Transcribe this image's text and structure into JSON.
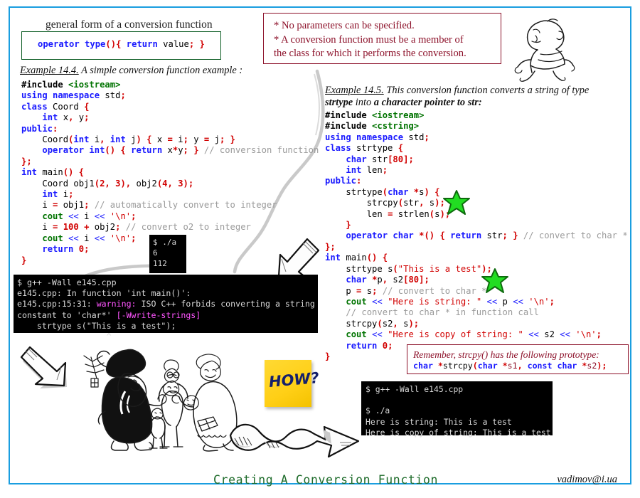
{
  "slide": {
    "title": "Creating A Conversion Function",
    "signature": "vadimov@i.ua",
    "border_color": "#1a9ee0"
  },
  "general_form": {
    "label": "general form of a conversion function",
    "code": "operator type(){ return value; }",
    "border_color": "#0b5c22"
  },
  "rules_note": {
    "line1": "* No parameters can be specified.",
    "line2": "* A conversion function must be a member of",
    "line3": "the class for which it performs the conversion.",
    "color": "#8c1029"
  },
  "example_444": {
    "number": "Example 14.4.",
    "caption": "A simple conversion function example :"
  },
  "example_445": {
    "number": "Example 14.5.",
    "caption_part1": "This conversion function converts a string of type",
    "caption_bold1": "strtype",
    "caption_part2": "into",
    "caption_bold2": "a character pointer to str:"
  },
  "code_left": [
    "#include <iostream>",
    "using namespace std;",
    "class Coord {",
    "    int x, y;",
    "public:",
    "    Coord(int i, int j) { x = i; y = j; }",
    "    operator int() { return x*y; } // conversion function",
    "};",
    "int main() {",
    "    Coord obj1(2, 3), obj2(4, 3);",
    "    int i;",
    "    i = obj1; // automatically convert to integer",
    "    cout << i << '\\n';",
    "    i = 100 + obj2; // convert o2 to integer",
    "    cout << i << '\\n';",
    "    return 0;",
    "}"
  ],
  "code_right": [
    "#include <iostream>",
    "#include <cstring>",
    "using namespace std;",
    "class strtype {",
    "    char str[80];",
    "    int len;",
    "public:",
    "    strtype(char *s) {",
    "        strcpy(str, s);",
    "        len = strlen(s);",
    "    }",
    "    operator char *() { return str; } // convert to char *",
    "};",
    "int main() {",
    "    strtype s(\"This is a test\");",
    "    char *p, s2[80];",
    "    p = s; // convert to char *",
    "    cout << \"Here is string: \" << p << '\\n';",
    "    // convert to char * in function call",
    "    strcpy(s2, s);",
    "    cout << \"Here is copy of string: \" << s2 << '\\n';",
    "    return 0;",
    "}"
  ],
  "terminal_small": {
    "lines": [
      "$ ./a",
      "6",
      "112"
    ]
  },
  "terminal_error": {
    "line1": "$ g++ -Wall e145.cpp",
    "line2": "e145.cpp: In function 'int main()':",
    "line3_prefix": "e145.cpp:15:31: ",
    "line3_warn": "warning:",
    "line3_rest": " ISO C++ forbids converting a string",
    "line4_prefix": "constant to 'char*' ",
    "line4_warn": "[-Wwrite-strings]",
    "line5": "    strtype s(\"This is a test\");",
    "line6": "                  ^"
  },
  "terminal_run": {
    "line1": "$ g++ -Wall e145.cpp",
    "line2": "",
    "line3": "$ ./a",
    "line4": "Here is string: This is a test",
    "line5": "Here is copy of string: This is a test"
  },
  "remember_note": {
    "text": "Remember, strcpy() has the following prototype:",
    "prototype": "char *strcpy(char *s1, const char *s2);",
    "color": "#8c1029"
  },
  "sticky_note": {
    "text": "HOW?",
    "color": "#ffcf16"
  },
  "decorations": {
    "baby": "walking-baby-illustration",
    "santa": "santa-with-children-illustration",
    "star1": "green-star-marker",
    "star2": "green-star-marker",
    "arrow_down_left": "hand-drawn-arrow",
    "arrow_down_left2": "hand-drawn-arrow",
    "arrow_wavy": "hand-drawn-wavy-arrow",
    "divider": "hand-drawn-curved-divider"
  }
}
